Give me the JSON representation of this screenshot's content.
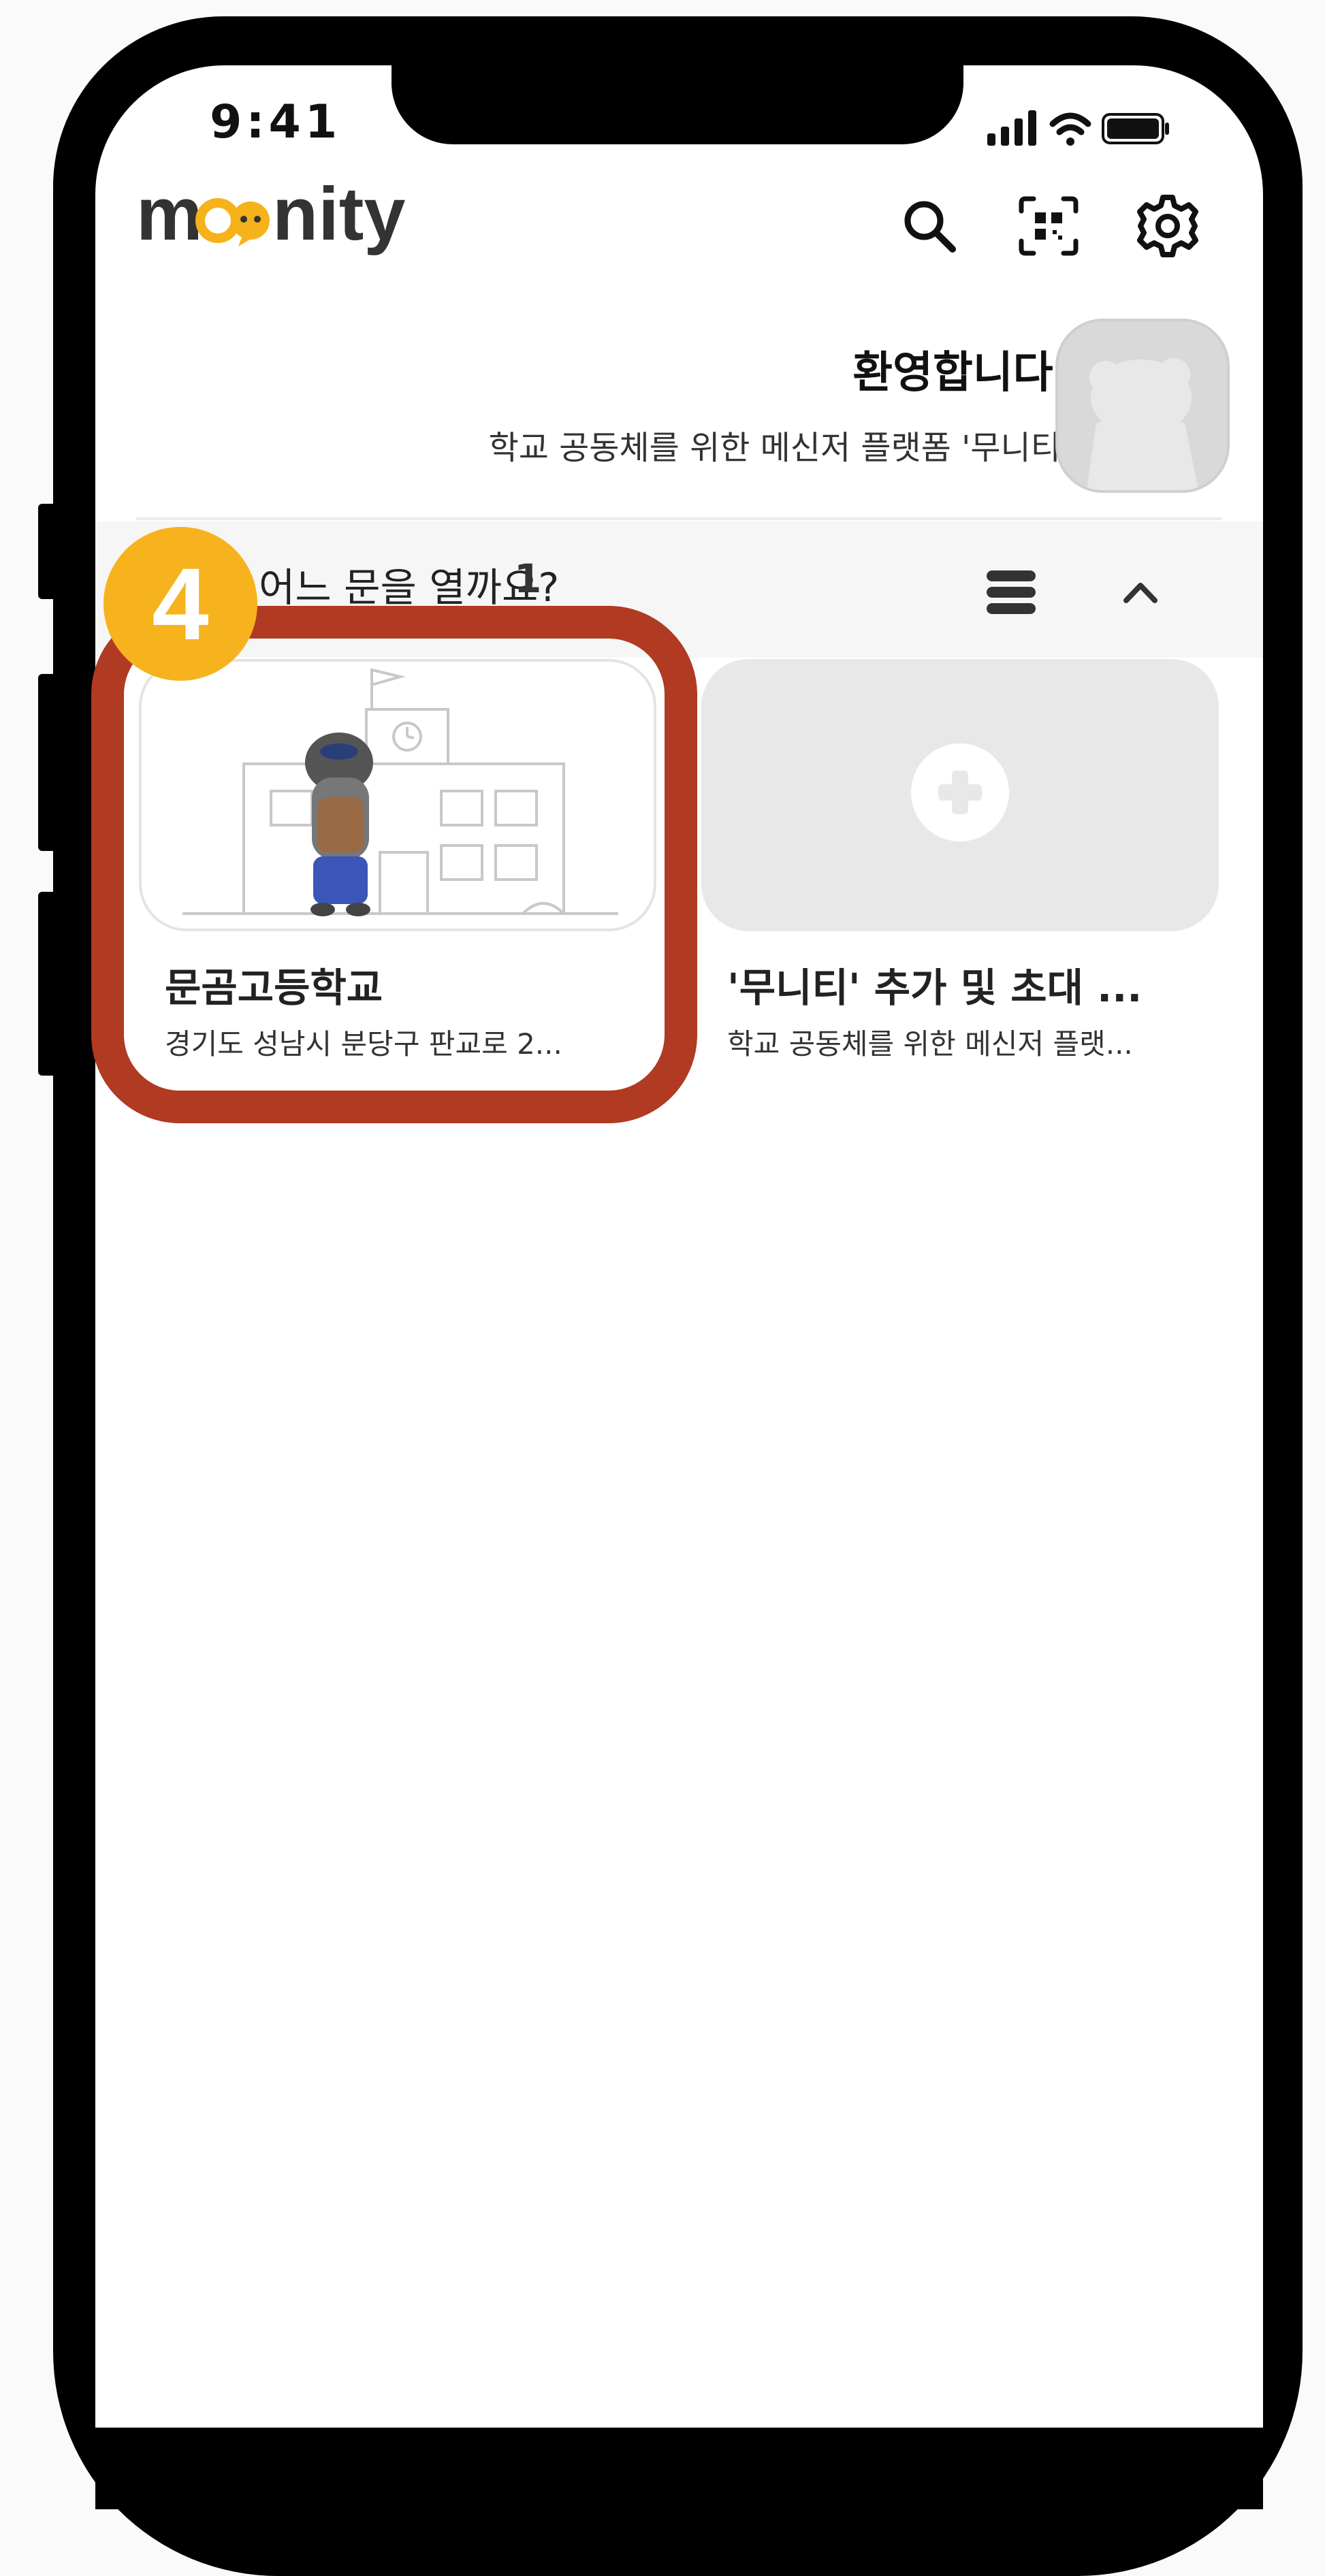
{
  "status": {
    "time": "9:41"
  },
  "header": {
    "logo_text": "mconity",
    "icons": [
      "search-icon",
      "qr-scan-icon",
      "settings-icon"
    ]
  },
  "welcome": {
    "title": "환영합니다.",
    "subtitle": "학교 공동체를 위한 메신저 플랫폼 '무니티'"
  },
  "section": {
    "title": "어느 문을 열까요?",
    "count": "1",
    "icons": [
      "list-icon",
      "chevron-up-icon"
    ]
  },
  "cards": [
    {
      "title": "문곰고등학교",
      "subtitle": "경기도 성남시 분당구 판교로 2..."
    },
    {
      "title": "'무니티' 추가 및 초대 ...",
      "subtitle": "학교 공동체를 위한 메신저 플랫..."
    }
  ],
  "tutorial": {
    "step": "4",
    "highlight_color": "#b03a22",
    "badge_color": "#f7b31d"
  },
  "colors": {
    "logo_dark": "#333333",
    "logo_accent": "#f5b21b"
  }
}
